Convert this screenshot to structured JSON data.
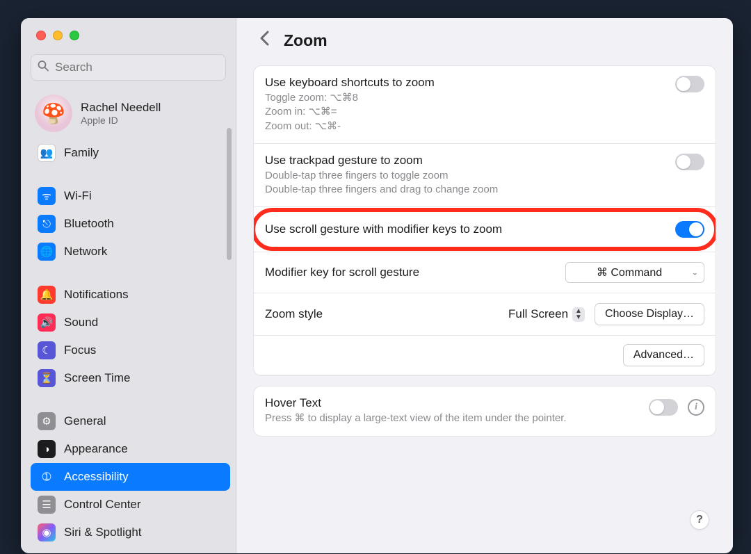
{
  "page_title": "Zoom",
  "search_placeholder": "Search",
  "account": {
    "name": "Rachel Needell",
    "sub": "Apple ID",
    "emoji": "🍄"
  },
  "sidebar": {
    "items": [
      {
        "label": "Family",
        "icon": "👥",
        "bg": "bg-white"
      },
      {
        "sep": true
      },
      {
        "label": "Wi-Fi",
        "icon": "ᯤ",
        "bg": "bg-blue"
      },
      {
        "label": "Bluetooth",
        "icon": "⎋",
        "bg": "bg-blue"
      },
      {
        "label": "Network",
        "icon": "🌐",
        "bg": "bg-blue"
      },
      {
        "sep": true
      },
      {
        "label": "Notifications",
        "icon": "🔔",
        "bg": "bg-red"
      },
      {
        "label": "Sound",
        "icon": "🔊",
        "bg": "bg-pink"
      },
      {
        "label": "Focus",
        "icon": "☾",
        "bg": "bg-indigo"
      },
      {
        "label": "Screen Time",
        "icon": "⏳",
        "bg": "bg-indigo"
      },
      {
        "sep": true
      },
      {
        "label": "General",
        "icon": "⚙",
        "bg": "bg-gray"
      },
      {
        "label": "Appearance",
        "icon": "◑",
        "bg": "bg-black"
      },
      {
        "label": "Accessibility",
        "icon": "➀",
        "bg": "bg-blue",
        "selected": true
      },
      {
        "label": "Control Center",
        "icon": "☰",
        "bg": "bg-gray"
      },
      {
        "label": "Siri & Spotlight",
        "icon": "◉",
        "bg": "bg-grad"
      }
    ]
  },
  "rows": {
    "kb": {
      "title": "Use keyboard shortcuts to zoom",
      "l1": "Toggle zoom: ⌥⌘8",
      "l2": "Zoom in: ⌥⌘=",
      "l3": "Zoom out: ⌥⌘-",
      "on": false
    },
    "tp": {
      "title": "Use trackpad gesture to zoom",
      "l1": "Double-tap three fingers to toggle zoom",
      "l2": "Double-tap three fingers and drag to change zoom",
      "on": false
    },
    "scroll": {
      "title": "Use scroll gesture with modifier keys to zoom",
      "on": true
    },
    "modkey": {
      "title": "Modifier key for scroll gesture",
      "value": "⌘ Command"
    },
    "style": {
      "title": "Zoom style",
      "value": "Full Screen",
      "button": "Choose Display…"
    },
    "advanced": "Advanced…",
    "hover": {
      "title": "Hover Text",
      "sub": "Press ⌘ to display a large-text view of the item under the pointer.",
      "on": false
    }
  },
  "help": "?"
}
